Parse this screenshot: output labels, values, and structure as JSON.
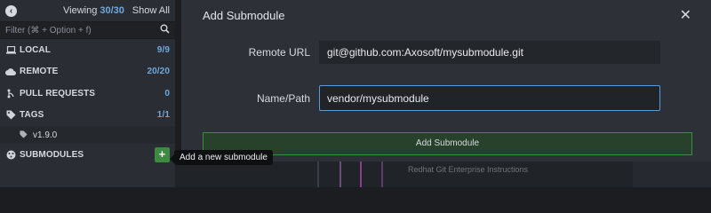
{
  "sidebar": {
    "viewing_label": "Viewing",
    "viewing_count": "30/30",
    "show_all": "Show All",
    "filter_placeholder": "Filter (⌘ + Option + f)",
    "sections": [
      {
        "label": "LOCAL",
        "count": "9/9",
        "icon": "laptop-icon"
      },
      {
        "label": "REMOTE",
        "count": "20/20",
        "icon": "cloud-icon"
      },
      {
        "label": "PULL REQUESTS",
        "count": "0",
        "icon": "pull-request-icon"
      },
      {
        "label": "TAGS",
        "count": "1/1",
        "icon": "tag-icon"
      }
    ],
    "tag_item": "v1.9.0",
    "submodules_label": "SUBMODULES",
    "add_button": "+",
    "tooltip": "Add a new submodule"
  },
  "modal": {
    "title": "Add Submodule",
    "close": "✕",
    "remote_url_label": "Remote URL",
    "remote_url_value": "git@github.com:Axosoft/mysubmodule.git",
    "name_path_label": "Name/Path",
    "name_path_value": "vendor/mysubmodule",
    "submit_label": "Add Submodule"
  },
  "background": {
    "ghost_text": "Redhat Git Enterprise Instructions"
  },
  "colors": {
    "accent_blue": "#6fa8dc",
    "accent_green": "#3d8b40",
    "focus_border": "#5b9bd5"
  }
}
